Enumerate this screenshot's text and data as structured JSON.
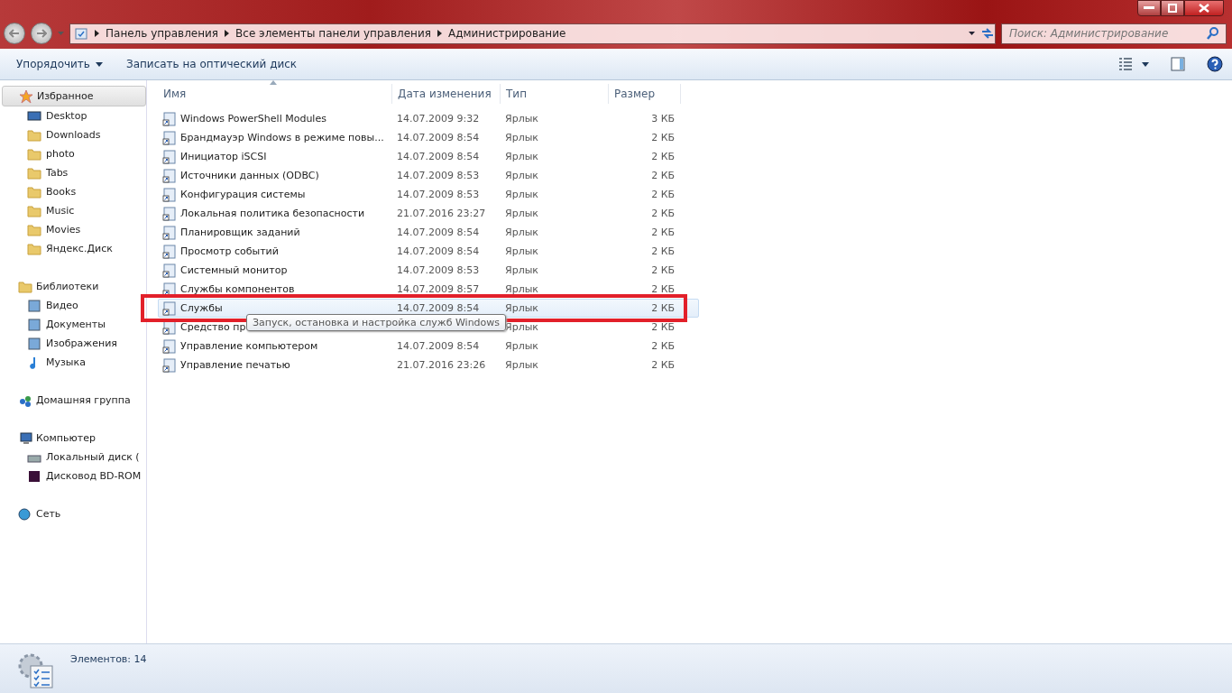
{
  "address_bar": {
    "breadcrumbs": [
      "Панель управления",
      "Все элементы панели управления",
      "Администрирование"
    ]
  },
  "search": {
    "placeholder": "Поиск: Администрирование"
  },
  "toolbar": {
    "buttons": [
      "Упорядочить",
      "Записать на оптический диск"
    ]
  },
  "sidebar": {
    "groups": [
      {
        "label": "Избранное",
        "selected": true,
        "children": [
          {
            "label": "Desktop"
          },
          {
            "label": "Downloads"
          },
          {
            "label": "photo"
          },
          {
            "label": "Tabs"
          },
          {
            "label": "Books"
          },
          {
            "label": "Music"
          },
          {
            "label": "Movies"
          },
          {
            "label": "Яндекс.Диск"
          }
        ]
      },
      {
        "label": "Библиотеки",
        "selected": false,
        "children": [
          {
            "label": "Видео"
          },
          {
            "label": "Документы"
          },
          {
            "label": "Изображения"
          },
          {
            "label": "Музыка"
          }
        ]
      },
      {
        "label": "Домашняя группа",
        "selected": false
      },
      {
        "label": "Компьютер",
        "selected": false,
        "children": [
          {
            "label": "Локальный диск ("
          },
          {
            "label": "Дисковод BD-ROM"
          }
        ]
      },
      {
        "label": "Сеть",
        "selected": false
      }
    ]
  },
  "table": {
    "columns": [
      "Имя",
      "Дата изменения",
      "Тип",
      "Размер"
    ],
    "rows": [
      {
        "name": "Windows PowerShell Modules",
        "date": "14.07.2009 9:32",
        "type": "Ярлык",
        "size": "3 КБ",
        "selected": false
      },
      {
        "name": "Брандмауэр Windows в режиме повы...",
        "date": "14.07.2009 8:54",
        "type": "Ярлык",
        "size": "2 КБ",
        "selected": false
      },
      {
        "name": "Инициатор iSCSI",
        "date": "14.07.2009 8:54",
        "type": "Ярлык",
        "size": "2 КБ",
        "selected": false
      },
      {
        "name": "Источники данных (ODBC)",
        "date": "14.07.2009 8:53",
        "type": "Ярлык",
        "size": "2 КБ",
        "selected": false
      },
      {
        "name": "Конфигурация системы",
        "date": "14.07.2009 8:53",
        "type": "Ярлык",
        "size": "2 КБ",
        "selected": false
      },
      {
        "name": "Локальная политика безопасности",
        "date": "21.07.2016 23:27",
        "type": "Ярлык",
        "size": "2 КБ",
        "selected": false
      },
      {
        "name": "Планировщик заданий",
        "date": "14.07.2009 8:54",
        "type": "Ярлык",
        "size": "2 КБ",
        "selected": false
      },
      {
        "name": "Просмотр событий",
        "date": "14.07.2009 8:54",
        "type": "Ярлык",
        "size": "2 КБ",
        "selected": false
      },
      {
        "name": "Системный монитор",
        "date": "14.07.2009 8:53",
        "type": "Ярлык",
        "size": "2 КБ",
        "selected": false
      },
      {
        "name": "Службы компонентов",
        "date": "14.07.2009 8:57",
        "type": "Ярлык",
        "size": "2 КБ",
        "selected": false
      },
      {
        "name": "Службы",
        "date": "14.07.2009 8:54",
        "type": "Ярлык",
        "size": "2 КБ",
        "selected": true
      },
      {
        "name": "Средство пр",
        "type": "Ярлык",
        "size": "2 КБ",
        "selected": false
      },
      {
        "name": "Управление компьютером",
        "date": "14.07.2009 8:54",
        "type": "Ярлык",
        "size": "2 КБ",
        "selected": false
      },
      {
        "name": "Управление печатью",
        "date": "21.07.2016 23:26",
        "type": "Ярлык",
        "size": "2 КБ",
        "selected": false
      }
    ]
  },
  "tooltip": {
    "text": "Запуск, остановка и настройка служб Windows"
  },
  "status_bar": {
    "text": "Элементов: 14"
  }
}
